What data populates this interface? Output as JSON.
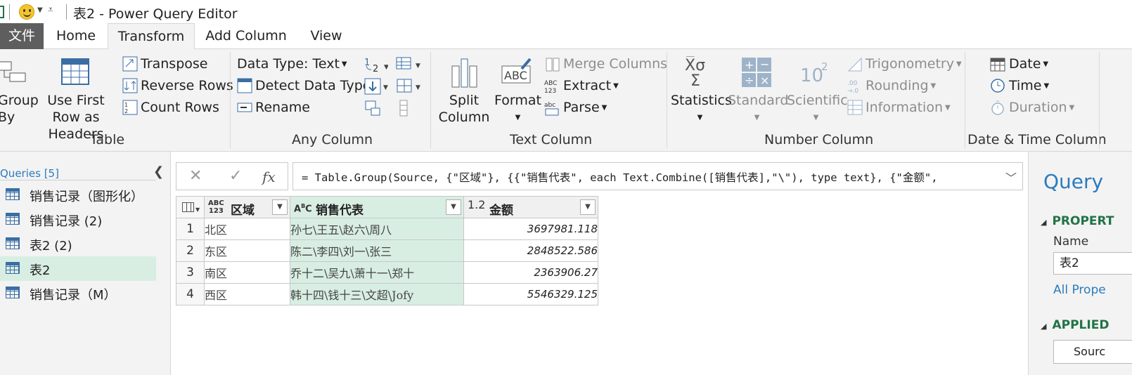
{
  "window": {
    "title": "表2 - Power Query Editor"
  },
  "tabs": [
    {
      "label": "文件"
    },
    {
      "label": "Home"
    },
    {
      "label": "Transform"
    },
    {
      "label": "Add Column"
    },
    {
      "label": "View"
    }
  ],
  "active_tab": "Transform",
  "ribbon": {
    "table": {
      "label": "Table",
      "group_by": "Group By",
      "use_first_row": "Use First Row as Headers",
      "transpose": "Transpose",
      "reverse_rows": "Reverse Rows",
      "count_rows": "Count Rows"
    },
    "any_column": {
      "label": "Any Column",
      "data_type": "Data Type: Text",
      "detect_data_type": "Detect Data Type",
      "rename": "Rename"
    },
    "text_column": {
      "label": "Text Column",
      "split_column": "Split Column",
      "format": "Format",
      "merge_columns": "Merge Columns",
      "extract": "Extract",
      "parse": "Parse"
    },
    "number_column": {
      "label": "Number Column",
      "statistics": "Statistics",
      "standard": "Standard",
      "scientific": "Scientific",
      "trigonometry": "Trigonometry",
      "rounding": "Rounding",
      "information": "Information"
    },
    "datetime_column": {
      "label": "Date & Time Column",
      "date": "Date",
      "time": "Time",
      "duration": "Duration"
    }
  },
  "queries": {
    "title": "Queries [5]",
    "items": [
      {
        "label": "销售记录（图形化）"
      },
      {
        "label": "销售记录 (2)"
      },
      {
        "label": "表2 (2)"
      },
      {
        "label": "表2"
      },
      {
        "label": "销售记录（M）"
      }
    ],
    "selected_index": 3
  },
  "formula": {
    "text": "= Table.Group(Source, {\"区域\"}, {{\"销售代表\", each Text.Combine([销售代表],\"\\\"), type text}, {\"金额\","
  },
  "table": {
    "columns": [
      {
        "type": "ABC\n123",
        "name": "区域"
      },
      {
        "type": "ABC",
        "name": "销售代表"
      },
      {
        "type": "1.2",
        "name": "金额"
      }
    ],
    "rows": [
      {
        "no": "1",
        "region": "北区",
        "reps": "孙七\\王五\\赵六\\周八",
        "amount": "3697981.118"
      },
      {
        "no": "2",
        "region": "东区",
        "reps": "陈二\\李四\\刘一\\张三",
        "amount": "2848522.586"
      },
      {
        "no": "3",
        "region": "南区",
        "reps": "乔十二\\吴九\\萧十一\\郑十",
        "amount": "2363906.27"
      },
      {
        "no": "4",
        "region": "西区",
        "reps": "韩十四\\钱十三\\文超\\Jofy",
        "amount": "5546329.125"
      }
    ]
  },
  "settings": {
    "title": "Query",
    "properties": "PROPERT",
    "name_label": "Name",
    "name_value": "表2",
    "all_properties": "All Prope",
    "applied_steps": "APPLIED",
    "step": "Sourc"
  },
  "colors": {
    "accent": "#217346",
    "link": "#2b7bbd",
    "selection": "#d9eee3"
  }
}
